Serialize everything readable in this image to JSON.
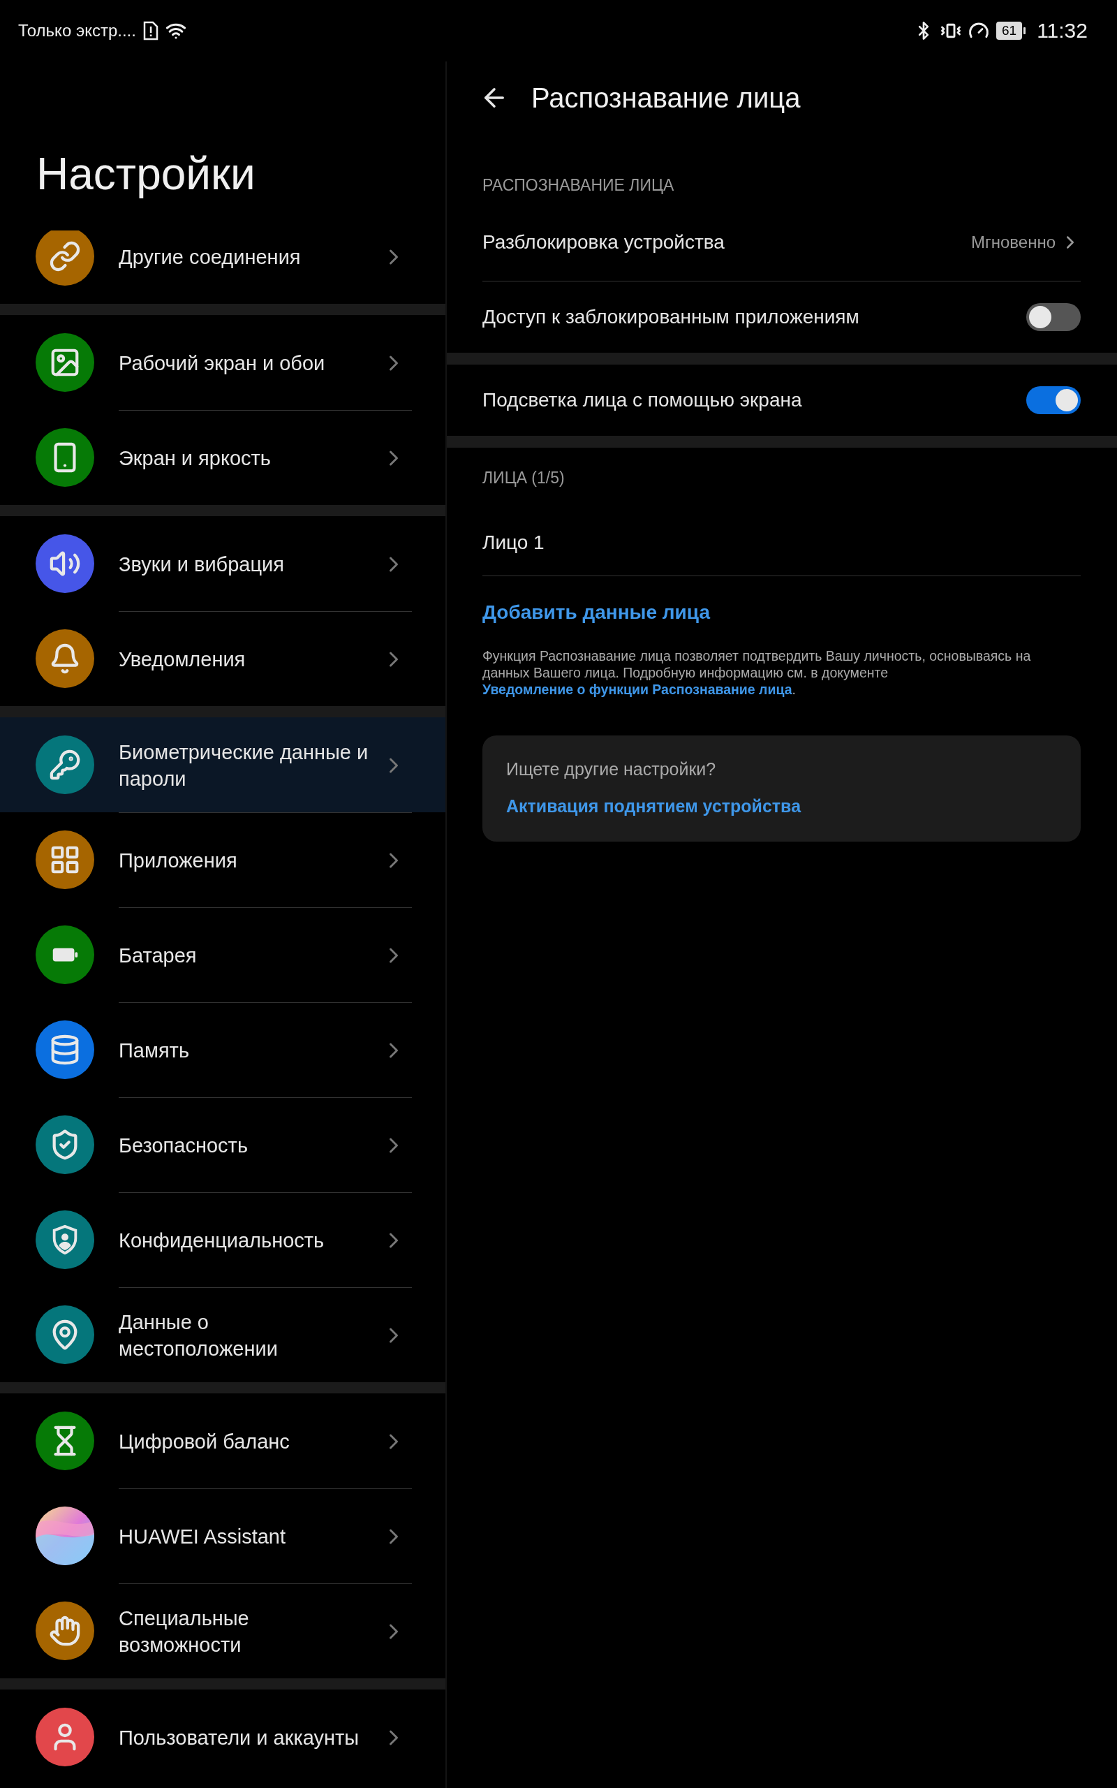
{
  "status_bar": {
    "carrier": "Только экстр....",
    "battery": "61",
    "time": "11:32"
  },
  "sidebar": {
    "title": "Настройки",
    "groups": [
      [
        {
          "label": "Другие соединения",
          "color": "#a66500",
          "selected": false
        }
      ],
      [
        {
          "label": "Рабочий экран и обои",
          "color": "#067a06",
          "selected": false
        },
        {
          "label": "Экран и яркость",
          "color": "#067a06",
          "selected": false
        }
      ],
      [
        {
          "label": "Звуки и вибрация",
          "color": "#4656e8",
          "selected": false
        },
        {
          "label": "Уведомления",
          "color": "#a66500",
          "selected": false
        }
      ],
      [
        {
          "label": "Биометрические данные и пароли",
          "color": "#05767b",
          "selected": true
        },
        {
          "label": "Приложения",
          "color": "#a66500",
          "selected": false
        },
        {
          "label": "Батарея",
          "color": "#067a06",
          "selected": false
        },
        {
          "label": "Память",
          "color": "#0b6fe0",
          "selected": false
        },
        {
          "label": "Безопасность",
          "color": "#05767b",
          "selected": false
        },
        {
          "label": "Конфиденциальность",
          "color": "#05767b",
          "selected": false
        },
        {
          "label": "Данные о местоположении",
          "color": "#05767b",
          "selected": false
        }
      ],
      [
        {
          "label": "Цифровой баланс",
          "color": "#067a06",
          "selected": false
        },
        {
          "label": "HUAWEI Assistant",
          "kind": "gradient",
          "selected": false
        },
        {
          "label": "Специальные возможности",
          "color": "#a66500",
          "selected": false
        }
      ],
      [
        {
          "label": "Пользователи и аккаунты",
          "color": "#e2474b",
          "selected": false
        }
      ]
    ]
  },
  "detail": {
    "title": "Распознавание лица",
    "sections": [
      {
        "header": "РАСПОЗНАВАНИЕ ЛИЦА",
        "rows": [
          {
            "kind": "value",
            "label": "Разблокировка устройства",
            "value": "Мгновенно"
          },
          {
            "kind": "toggle",
            "label": "Доступ к заблокированным приложениям",
            "on": false
          }
        ]
      },
      {
        "rows": [
          {
            "kind": "toggle",
            "label": "Подсветка лица с помощью экрана",
            "on": true
          }
        ]
      },
      {
        "header": "ЛИЦА (1/5)",
        "rows": [
          {
            "kind": "plain",
            "label": "Лицо 1"
          }
        ]
      }
    ],
    "add_link": "Добавить данные лица",
    "note": {
      "text": "Функция Распознавание лица позволяет подтвердить Вашу личность, основываясь на данных Вашего лица. Подробную информацию см. в документе ",
      "link": "Уведомление о функции Распознавание лица",
      "end": "."
    },
    "card": {
      "question": "Ищете другие настройки?",
      "link": "Активация поднятием устройства"
    }
  }
}
